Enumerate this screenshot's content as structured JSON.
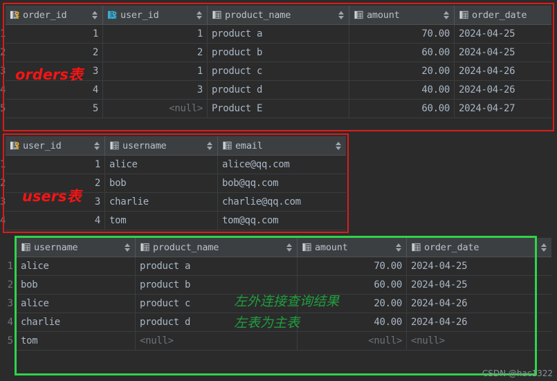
{
  "theme": {
    "page_bg": "#2b2b2b",
    "header_bg": "#3c3f41",
    "text": "#a9b7c6",
    "null_text": "#6d7479",
    "red_accent": "#e01b1b",
    "green_accent": "#2fd44b",
    "green_text": "#1f9e3e",
    "pk_key_color": "#e8b339",
    "fk_icon_color": "#36b0d9"
  },
  "annotations": {
    "orders_label": "orders表",
    "users_label": "users表",
    "result_line1": "左外连接查询结果",
    "result_line2": "左表为主表",
    "watermark": "CSDN @hac1322"
  },
  "tables": {
    "orders": {
      "name": "orders",
      "columns": [
        {
          "label": "order_id",
          "icon": "primary-key-column-icon",
          "sortable": true,
          "align": "right"
        },
        {
          "label": "user_id",
          "icon": "foreign-key-column-icon",
          "sortable": true,
          "align": "right"
        },
        {
          "label": "product_name",
          "icon": "table-column-icon",
          "sortable": true,
          "align": "left"
        },
        {
          "label": "amount",
          "icon": "table-column-icon",
          "sortable": true,
          "align": "right"
        },
        {
          "label": "order_date",
          "icon": "table-column-icon",
          "sortable": false,
          "align": "left"
        }
      ],
      "rows": [
        {
          "n": "1",
          "cells": [
            "1",
            "1",
            "product a",
            "70.00",
            "2024-04-25"
          ]
        },
        {
          "n": "2",
          "cells": [
            "2",
            "2",
            "product b",
            "60.00",
            "2024-04-25"
          ]
        },
        {
          "n": "3",
          "cells": [
            "3",
            "1",
            "product c",
            "20.00",
            "2024-04-26"
          ]
        },
        {
          "n": "4",
          "cells": [
            "4",
            "3",
            "product d",
            "40.00",
            "2024-04-26"
          ]
        },
        {
          "n": "5",
          "cells": [
            "5",
            "<null>",
            "Product E",
            "60.00",
            "2024-04-27"
          ]
        }
      ]
    },
    "users": {
      "name": "users",
      "columns": [
        {
          "label": "user_id",
          "icon": "primary-key-column-icon",
          "sortable": true,
          "align": "right"
        },
        {
          "label": "username",
          "icon": "table-column-icon",
          "sortable": true,
          "align": "left"
        },
        {
          "label": "email",
          "icon": "table-column-icon",
          "sortable": true,
          "align": "left"
        }
      ],
      "rows": [
        {
          "n": "1",
          "cells": [
            "1",
            "alice",
            "alice@qq.com"
          ]
        },
        {
          "n": "2",
          "cells": [
            "2",
            "bob",
            "bob@qq.com"
          ]
        },
        {
          "n": "3",
          "cells": [
            "3",
            "charlie",
            "charlie@qq.com"
          ]
        },
        {
          "n": "4",
          "cells": [
            "4",
            "tom",
            "tom@qq.com"
          ]
        }
      ]
    },
    "result": {
      "name": "left join result",
      "columns": [
        {
          "label": "username",
          "icon": "table-column-icon",
          "sortable": true,
          "align": "left"
        },
        {
          "label": "product_name",
          "icon": "table-column-icon",
          "sortable": true,
          "align": "left"
        },
        {
          "label": "amount",
          "icon": "table-column-icon",
          "sortable": true,
          "align": "right"
        },
        {
          "label": "order_date",
          "icon": "table-column-icon",
          "sortable": true,
          "align": "left"
        }
      ],
      "rows": [
        {
          "n": "1",
          "cells": [
            "alice",
            "product a",
            "70.00",
            "2024-04-25"
          ]
        },
        {
          "n": "2",
          "cells": [
            "bob",
            "product b",
            "60.00",
            "2024-04-25"
          ]
        },
        {
          "n": "3",
          "cells": [
            "alice",
            "product c",
            "20.00",
            "2024-04-26"
          ]
        },
        {
          "n": "4",
          "cells": [
            "charlie",
            "product d",
            "40.00",
            "2024-04-26"
          ]
        },
        {
          "n": "5",
          "cells": [
            "tom",
            "<null>",
            "<null>",
            "<null>"
          ]
        }
      ]
    }
  }
}
